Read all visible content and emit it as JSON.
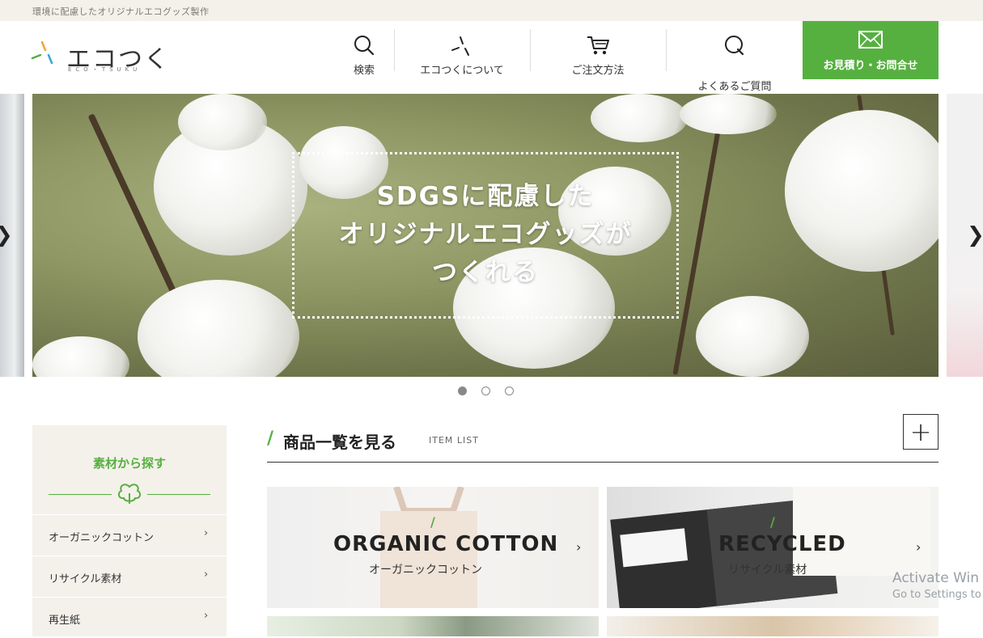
{
  "topbar": {
    "text": "環境に配慮したオリジナルエコグッズ製作"
  },
  "logo": {
    "text": "エコつく",
    "sub": "ECO・TSUKU"
  },
  "nav": {
    "search": "検索",
    "about": "エコつくについて",
    "order": "ご注文方法",
    "faq": "よくあるご質問",
    "contact": "お見積り・お問合せ"
  },
  "hero": {
    "line1": "SDGSに配慮した",
    "line2": "オリジナルエコグッズが",
    "line3": "つくれる"
  },
  "sidebar": {
    "title": "素材から探す",
    "items": [
      {
        "label": "オーガニックコットン"
      },
      {
        "label": "リサイクル素材"
      },
      {
        "label": "再生紙"
      }
    ]
  },
  "section": {
    "title": "商品一覧を見る",
    "sub": "ITEM LIST"
  },
  "cards": [
    {
      "en": "ORGANIC COTTON",
      "jp": "オーガニックコットン"
    },
    {
      "en": "RECYCLED",
      "jp": "リサイクル素材"
    }
  ],
  "watermark": {
    "line1": "Activate Win",
    "line2": "Go to Settings to"
  },
  "colors": {
    "brand_green": "#56b040",
    "topbar_bg": "#f4f1ea"
  }
}
